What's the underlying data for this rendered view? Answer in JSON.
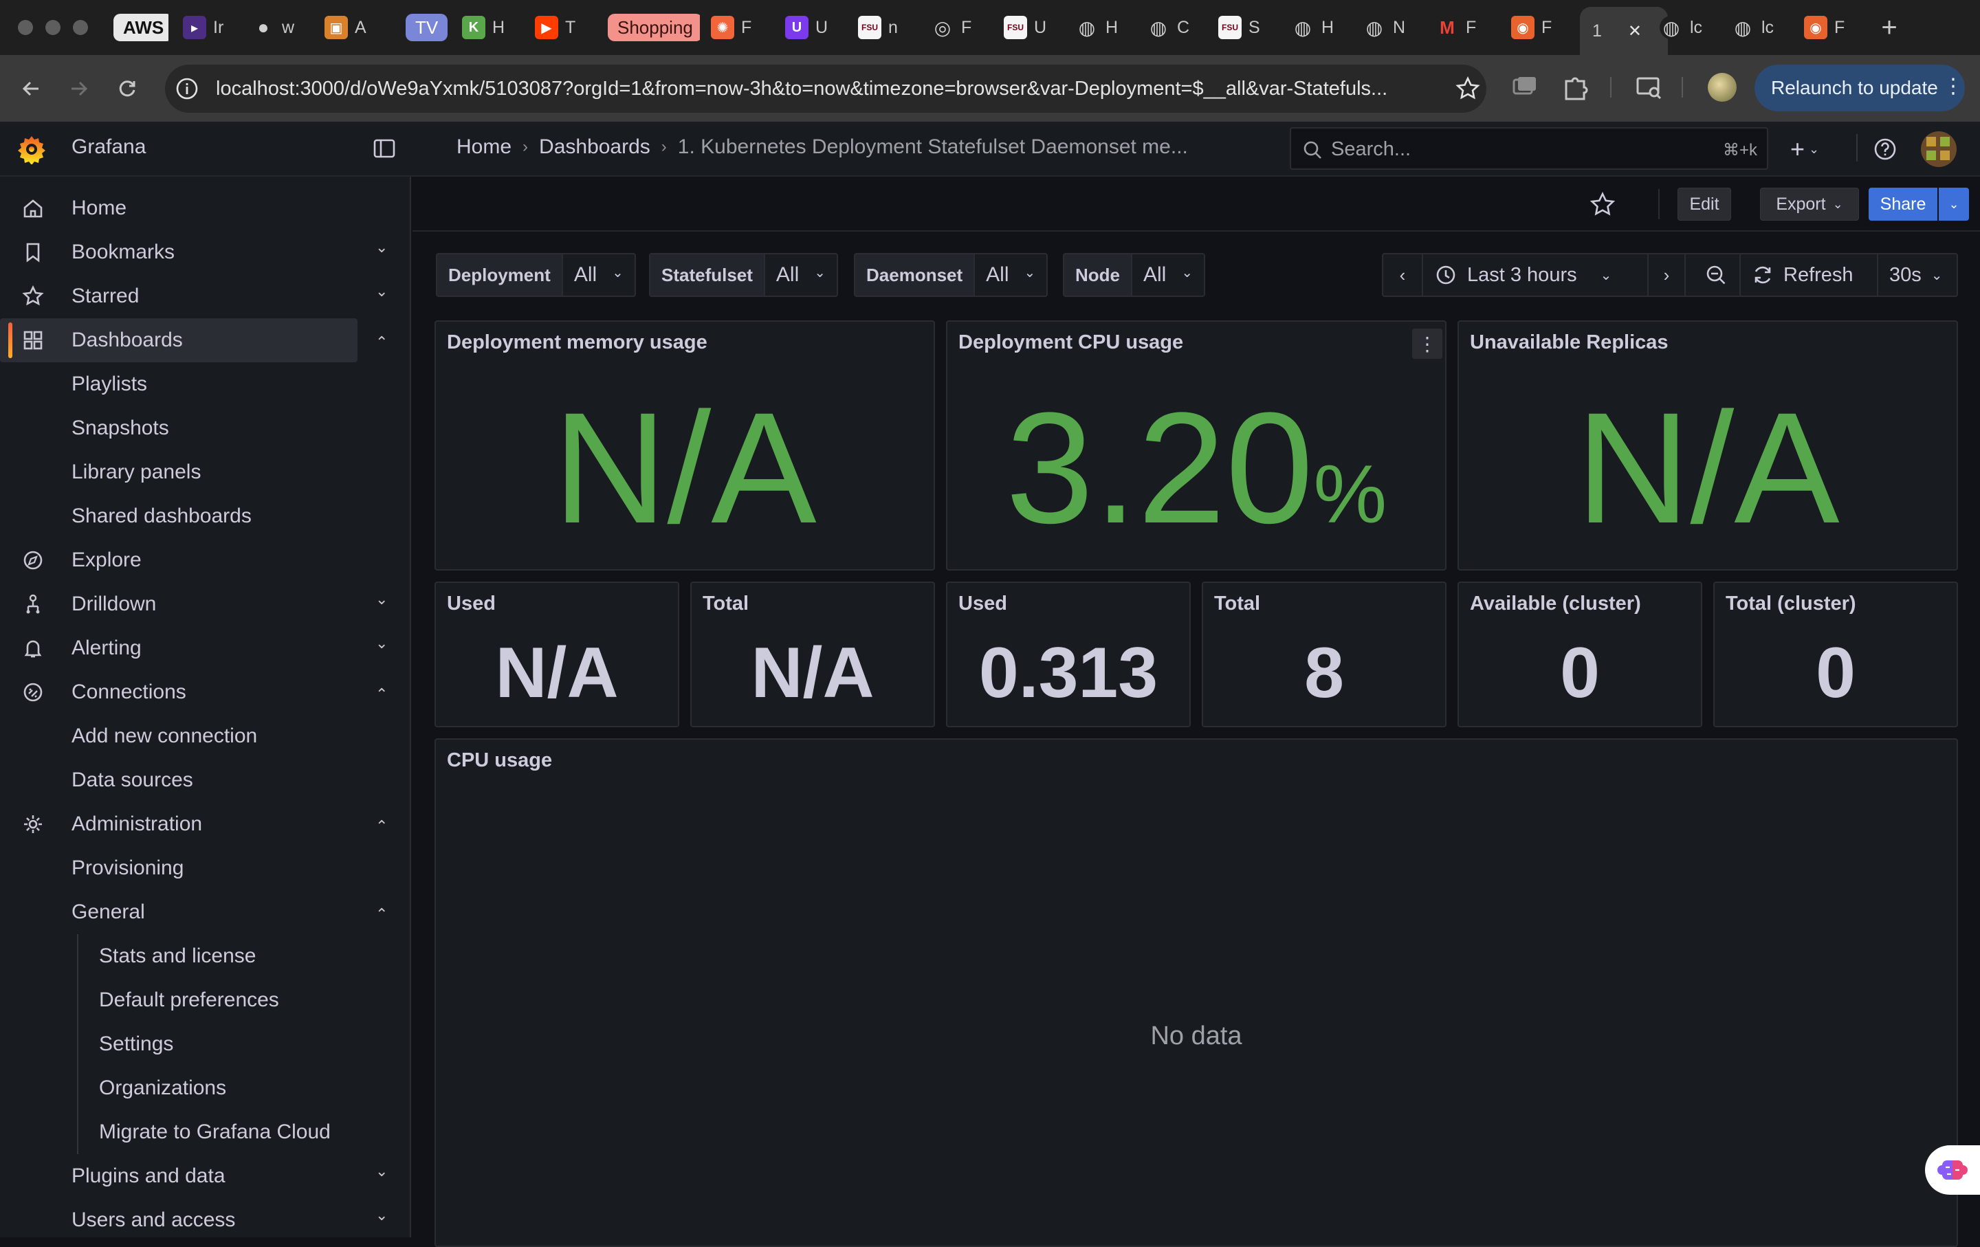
{
  "browser": {
    "tabs": [
      {
        "label": "AWS",
        "icon": "aws-icon"
      },
      {
        "label": "Ir",
        "icon": "terminal-icon"
      },
      {
        "label": "w",
        "icon": "github-icon"
      },
      {
        "label": "A",
        "icon": "app-icon"
      },
      {
        "label": "TV",
        "icon": "tv-icon"
      },
      {
        "label": "H",
        "icon": "k-icon"
      },
      {
        "label": "T",
        "icon": "youtube-icon"
      },
      {
        "label": "Shopping",
        "icon": "shopping-icon"
      },
      {
        "label": "F",
        "icon": "wheel-icon"
      },
      {
        "label": "U",
        "icon": "u-icon"
      },
      {
        "label": "n",
        "icon": "fsu-icon"
      },
      {
        "label": "F",
        "icon": "openai-icon"
      },
      {
        "label": "U",
        "icon": "fsu-icon"
      },
      {
        "label": "H",
        "icon": "globe-icon"
      },
      {
        "label": "C",
        "icon": "globe-icon"
      },
      {
        "label": "S",
        "icon": "fsu-icon"
      },
      {
        "label": "H",
        "icon": "globe-icon"
      },
      {
        "label": "N",
        "icon": "globe-icon"
      },
      {
        "label": "F",
        "icon": "gmail-icon"
      },
      {
        "label": "F",
        "icon": "grafana-icon"
      },
      {
        "label": "1",
        "icon": "",
        "active": true
      },
      {
        "label": "lc",
        "icon": "globe-icon"
      },
      {
        "label": "lc",
        "icon": "globe-icon"
      },
      {
        "label": "F",
        "icon": "grafana-icon"
      }
    ],
    "url": "localhost:3000/d/oWe9aYxmk/5103087?orgId=1&from=now-3h&to=now&timezone=browser&var-Deployment=$__all&var-Statefuls...",
    "relaunch_label": "Relaunch to update"
  },
  "grafana": {
    "brand": "Grafana",
    "breadcrumb": {
      "home": "Home",
      "dashboards": "Dashboards",
      "current": "1. Kubernetes Deployment Statefulset Daemonset me..."
    },
    "search": {
      "placeholder": "Search...",
      "shortcut": "⌘+k"
    },
    "toolbar": {
      "edit": "Edit",
      "export": "Export",
      "share": "Share"
    },
    "nav": [
      {
        "label": "Home",
        "icon": "home-icon",
        "level": 0
      },
      {
        "label": "Bookmarks",
        "icon": "bookmark-icon",
        "level": 0,
        "chevron": "down"
      },
      {
        "label": "Starred",
        "icon": "star-icon",
        "level": 0,
        "chevron": "down"
      },
      {
        "label": "Dashboards",
        "icon": "dashboards-icon",
        "level": 0,
        "chevron": "up",
        "active": true
      },
      {
        "label": "Playlists",
        "level": 1
      },
      {
        "label": "Snapshots",
        "level": 1
      },
      {
        "label": "Library panels",
        "level": 1
      },
      {
        "label": "Shared dashboards",
        "level": 1
      },
      {
        "label": "Explore",
        "icon": "compass-icon",
        "level": 0
      },
      {
        "label": "Drilldown",
        "icon": "drilldown-icon",
        "level": 0,
        "chevron": "down"
      },
      {
        "label": "Alerting",
        "icon": "bell-icon",
        "level": 0,
        "chevron": "down"
      },
      {
        "label": "Connections",
        "icon": "connections-icon",
        "level": 0,
        "chevron": "up"
      },
      {
        "label": "Add new connection",
        "level": 1
      },
      {
        "label": "Data sources",
        "level": 1
      },
      {
        "label": "Administration",
        "icon": "cog-icon",
        "level": 0,
        "chevron": "up"
      },
      {
        "label": "Provisioning",
        "level": 1
      },
      {
        "label": "General",
        "level": 1,
        "chevron": "up"
      },
      {
        "label": "Stats and license",
        "level": 2
      },
      {
        "label": "Default preferences",
        "level": 2
      },
      {
        "label": "Settings",
        "level": 2
      },
      {
        "label": "Organizations",
        "level": 2
      },
      {
        "label": "Migrate to Grafana Cloud",
        "level": 2
      },
      {
        "label": "Plugins and data",
        "level": 1,
        "chevron": "down"
      },
      {
        "label": "Users and access",
        "level": 1,
        "chevron": "down"
      }
    ],
    "variables": [
      {
        "label": "Deployment",
        "value": "All"
      },
      {
        "label": "Statefulset",
        "value": "All"
      },
      {
        "label": "Daemonset",
        "value": "All"
      },
      {
        "label": "Node",
        "value": "All"
      }
    ],
    "timepicker": {
      "range": "Last 3 hours",
      "refresh": "Refresh",
      "interval": "30s"
    },
    "panels": {
      "mem": {
        "title": "Deployment memory usage",
        "value": "N/A"
      },
      "cpu": {
        "title": "Deployment CPU usage",
        "value": "3.20",
        "unit": "%"
      },
      "replicas": {
        "title": "Unavailable Replicas",
        "value": "N/A"
      },
      "mem_used": {
        "title": "Used",
        "value": "N/A"
      },
      "mem_total": {
        "title": "Total",
        "value": "N/A"
      },
      "cpu_used": {
        "title": "Used",
        "value": "0.313"
      },
      "cpu_total": {
        "title": "Total",
        "value": "8"
      },
      "avail_cluster": {
        "title": "Available (cluster)",
        "value": "0"
      },
      "total_cluster": {
        "title": "Total (cluster)",
        "value": "0"
      },
      "cpu_usage": {
        "title": "CPU usage",
        "nodata": "No data"
      }
    },
    "colors": {
      "stat_green": "#56a64b",
      "share_blue": "#3d71d9",
      "brand_orange": "#f55f3e"
    }
  }
}
